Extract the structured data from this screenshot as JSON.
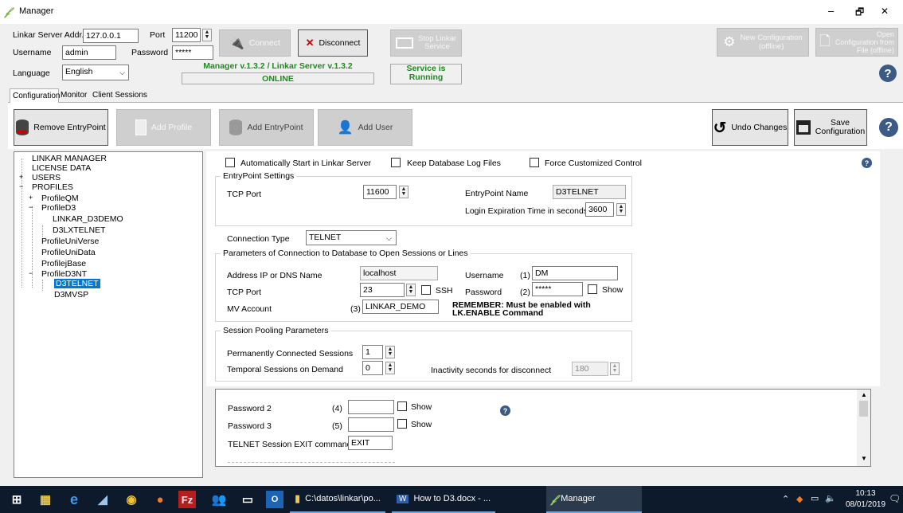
{
  "window": {
    "title": "Manager",
    "minimize": "–",
    "maximize": "🗗",
    "close": "✕"
  },
  "connection": {
    "server_addr_label": "Linkar Server Addr.",
    "server_addr": "127.0.0.1",
    "port_label": "Port",
    "port": "11200",
    "username_label": "Username",
    "username": "admin",
    "password_label": "Password",
    "password": "*****",
    "language_label": "Language",
    "language": "English",
    "connect": "Connect",
    "disconnect": "Disconnect",
    "version": "Manager v.1.3.2 / Linkar Server v.1.3.2",
    "status": "ONLINE",
    "stop_service_line1": "Stop Linkar",
    "stop_service_line2": "Service",
    "service_line1": "Service is",
    "service_line2": "Running",
    "new_config_line1": "New Configuration",
    "new_config_line2": "(offline)",
    "open_config_line1": "Open",
    "open_config_line2": "Configuration from",
    "open_config_line3": "File (offline)",
    "help": "?"
  },
  "tabs": [
    "Configuration",
    "Monitor",
    "Client Sessions"
  ],
  "toolbar": {
    "remove_entrypoint": "Remove EntryPoint",
    "add_profile": "Add Profile",
    "add_entrypoint": "Add EntryPoint",
    "add_user": "Add User",
    "undo": "Undo Changes",
    "save_line1": "Save",
    "save_line2": "Configuration",
    "help": "?"
  },
  "tree": {
    "items": [
      "LINKAR MANAGER",
      "LICENSE DATA",
      "USERS",
      "PROFILES",
      "ProfileQM",
      "ProfileD3",
      "LINKAR_D3DEMO",
      "D3LXTELNET",
      "ProfileUniVerse",
      "ProfileUniData",
      "ProfilejBase",
      "ProfileD3NT",
      "D3TELNET",
      "D3MVSP"
    ],
    "expand_plus": "+",
    "expand_minus": "−"
  },
  "options": {
    "auto_start": "Automatically Start in Linkar Server",
    "keep_logs": "Keep Database Log Files",
    "force_control": "Force Customized Control",
    "help": "?"
  },
  "entrypoint": {
    "title": "EntryPoint Settings",
    "tcp_port_label": "TCP Port",
    "tcp_port": "11600",
    "name_label": "EntryPoint Name",
    "name": "D3TELNET",
    "login_exp_label": "Login Expiration Time in seconds",
    "login_exp": "3600"
  },
  "connection_type": {
    "label": "Connection Type",
    "value": "TELNET"
  },
  "db_params": {
    "title": "Parameters of Connection to Database to Open Sessions or Lines",
    "address_label": "Address IP or DNS Name",
    "address": "localhost",
    "tcp_port_label": "TCP Port",
    "tcp_port": "23",
    "ssh_label": "SSH",
    "mv_account_label": "MV Account",
    "mv_marker": "(3)",
    "mv_account": "LINKAR_DEMO",
    "username_label": "Username",
    "user_marker": "(1)",
    "username": "DM",
    "password_label": "Password",
    "pass_marker": "(2)",
    "password": "*****",
    "show_label": "Show",
    "remember_line1": "REMEMBER: Must be enabled with",
    "remember_line2": "LK.ENABLE Command"
  },
  "pooling": {
    "title": "Session Pooling Parameters",
    "permanent_label": "Permanently Connected Sessions",
    "permanent": "1",
    "temporal_label": "Temporal Sessions on Demand",
    "temporal": "0",
    "inactivity_label": "Inactivity seconds for disconnect",
    "inactivity": "180"
  },
  "extra": {
    "password2_label": "Password 2",
    "p2_marker": "(4)",
    "password3_label": "Password 3",
    "p3_marker": "(5)",
    "show_label": "Show",
    "exit_label": "TELNET Session EXIT command",
    "exit_value": "EXIT",
    "help": "?"
  },
  "taskbar": {
    "explorer_label": "C:\\datos\\linkar\\po...",
    "word_label": "How to D3.docx - ...",
    "manager_label": "Manager",
    "outlook_label": "O",
    "time": "10:13",
    "date": "08/01/2019"
  }
}
